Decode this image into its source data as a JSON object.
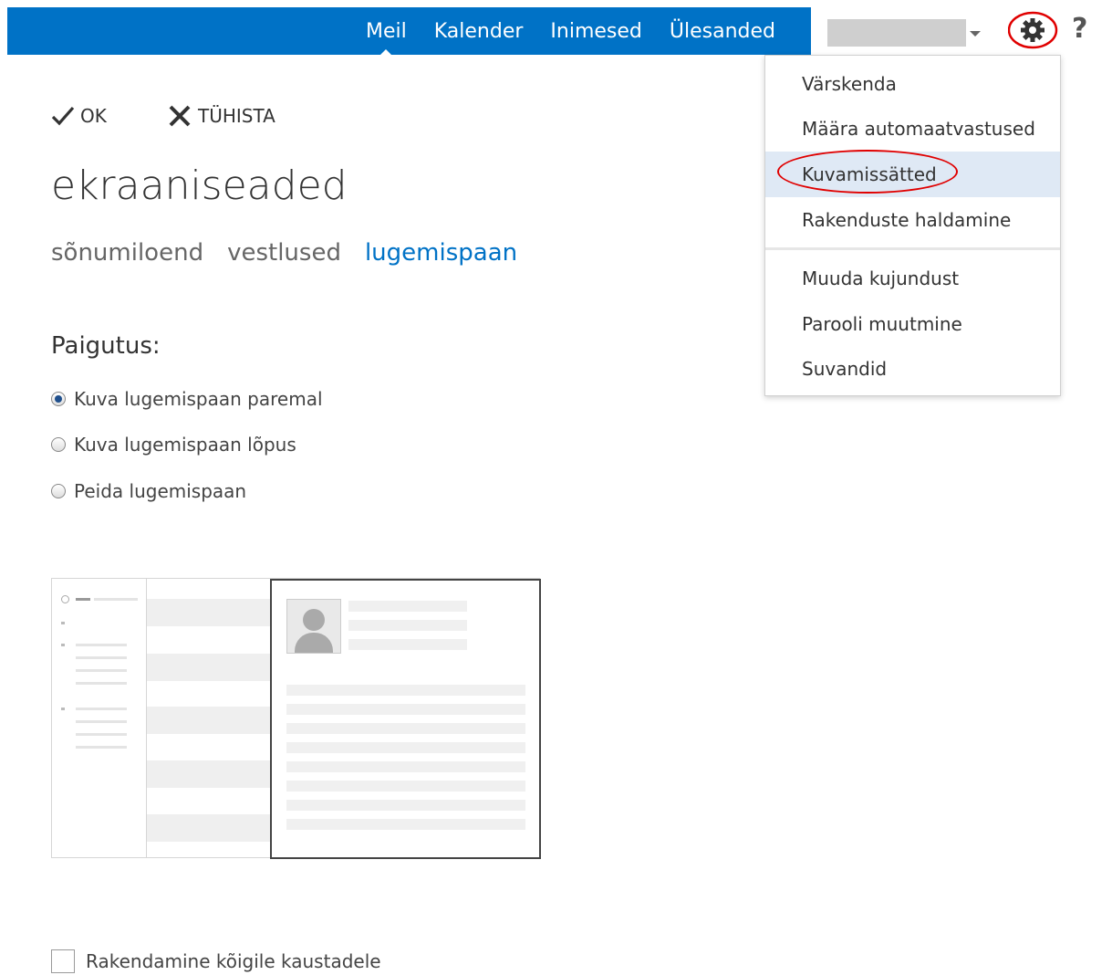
{
  "topnav": {
    "items": [
      {
        "label": "Meil",
        "active": true
      },
      {
        "label": "Kalender"
      },
      {
        "label": "Inimesed"
      },
      {
        "label": "Ülesanded"
      }
    ],
    "help_label": "?"
  },
  "commands": {
    "ok_label": "OK",
    "cancel_label": "TÜHISTA"
  },
  "page": {
    "title": "ekraaniseaded",
    "tabs": [
      "sõnumiloend",
      "vestlused",
      "lugemispaan"
    ],
    "active_tab": "lugemispaan"
  },
  "layout": {
    "label": "Paigutus:",
    "options": [
      {
        "label": "Kuva lugemispaan paremal",
        "checked": true
      },
      {
        "label": "Kuva lugemispaan lõpus",
        "checked": false
      },
      {
        "label": "Peida lugemispaan",
        "checked": false
      }
    ]
  },
  "apply_all": {
    "label": "Rakendamine kõigile kaustadele",
    "checked": false
  },
  "settings_menu": {
    "items": [
      "Värskenda",
      "Määra automaatvastused",
      "Kuvamissätted",
      "Rakenduste haldamine",
      "Muuda kujundust",
      "Parooli muutmine",
      "Suvandid"
    ],
    "highlighted": "Kuvamissätted"
  },
  "colors": {
    "accent": "#0072c6",
    "highlight": "#dfe9f5",
    "annotation": "#e00000"
  },
  "icons": {
    "gear": "gear-icon",
    "ok": "checkmark-icon",
    "cancel": "close-icon",
    "user_caret": "chevron-down-icon"
  }
}
